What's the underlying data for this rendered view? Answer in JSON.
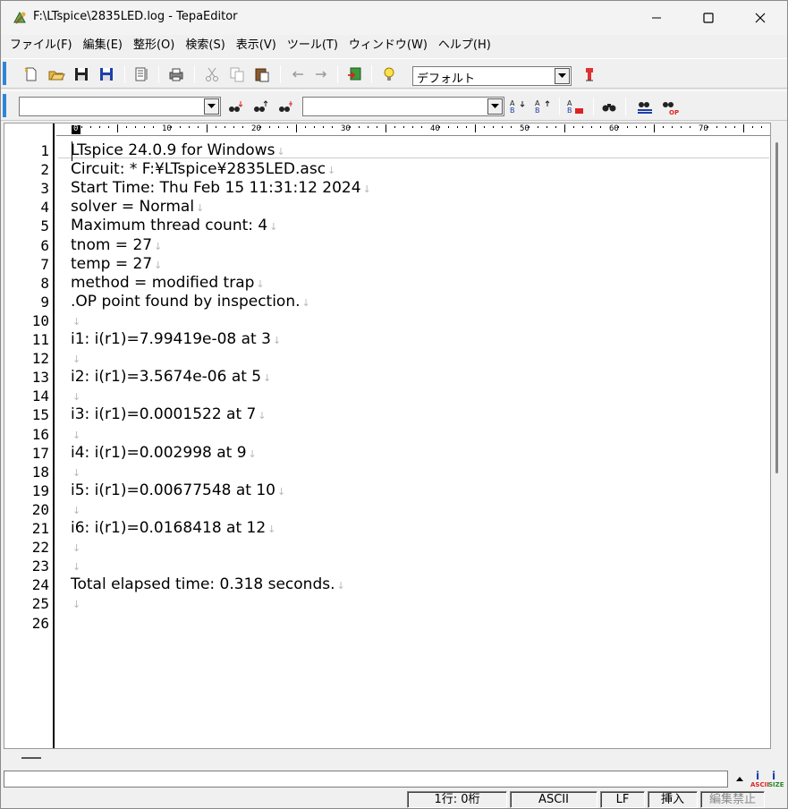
{
  "window": {
    "title": "F:\\LTspice\\2835LED.log - TepaEditor"
  },
  "menu": [
    "ファイル(F)",
    "編集(E)",
    "整形(O)",
    "検索(S)",
    "表示(V)",
    "ツール(T)",
    "ウィンドウ(W)",
    "ヘルプ(H)"
  ],
  "toolbar": {
    "font_combo_value": "デフォルト",
    "search_combo_value": "",
    "replace_combo_value": ""
  },
  "ruler": {
    "marks": [
      "0",
      "10",
      "20",
      "30",
      "40",
      "50",
      "60",
      "70"
    ]
  },
  "editor": {
    "line_numbers": [
      "1",
      "2",
      "3",
      "4",
      "5",
      "6",
      "7",
      "8",
      "9",
      "10",
      "11",
      "12",
      "13",
      "14",
      "15",
      "16",
      "17",
      "18",
      "19",
      "20",
      "21",
      "22",
      "23",
      "24",
      "25",
      "26"
    ],
    "lines": [
      "LTspice 24.0.9 for Windows",
      "Circuit: * F:¥LTspice¥2835LED.asc",
      "Start Time: Thu Feb 15 11:31:12 2024",
      "solver = Normal",
      "Maximum thread count: 4",
      "tnom = 27",
      "temp = 27",
      "method = modified trap",
      ".OP point found by inspection.",
      "",
      "i1: i(r1)=7.99419e-08 at 3",
      "",
      "i2: i(r1)=3.5674e-06 at 5",
      "",
      "i3: i(r1)=0.0001522 at 7",
      "",
      "i4: i(r1)=0.002998 at 9",
      "",
      "i5: i(r1)=0.00677548 at 10",
      "",
      "i6: i(r1)=0.0168418 at 12",
      "",
      "",
      "Total elapsed time: 0.318 seconds.",
      "",
      ""
    ],
    "eol_mark": "↓"
  },
  "status": {
    "position": "1行: 0桁",
    "encoding": "ASCII",
    "line_ending": "LF",
    "insert_mode": "挿入",
    "edit_lock": "編集禁止",
    "ascii_label": "ASCII",
    "size_label": "SIZE"
  },
  "colors": {
    "accent": "#2f86d8",
    "eol": "#b8b8b8"
  }
}
